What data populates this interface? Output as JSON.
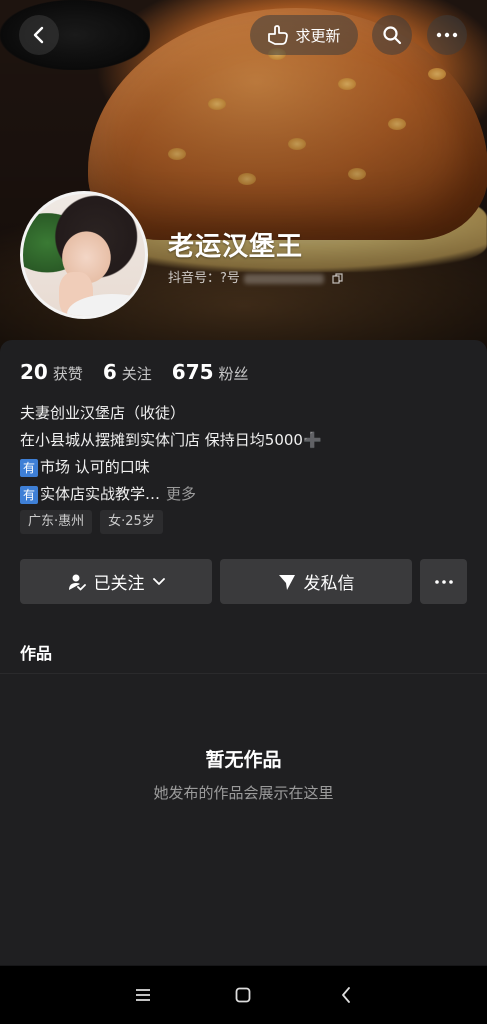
{
  "header": {
    "update_label": "求更新"
  },
  "profile": {
    "name": "老运汉堡王",
    "id_label": "抖音号：",
    "id_prefix": "?号"
  },
  "stats": [
    {
      "num": "20",
      "label": "获赞"
    },
    {
      "num": "6",
      "label": "关注"
    },
    {
      "num": "675",
      "label": "粉丝"
    }
  ],
  "bio": {
    "line1": "夫妻创业汉堡店（收徒）",
    "line2": "在小县城从摆摊到实体门店 保持日均5000",
    "line2_plus": "➕",
    "tag_char": "有",
    "line3": "市场 认可的口味",
    "line4": "实体店实战教学…",
    "more": "更多"
  },
  "chips": [
    "广东·惠州",
    "女·25岁"
  ],
  "actions": {
    "follow": "已关注",
    "message": "发私信"
  },
  "tabs": {
    "works": "作品"
  },
  "empty": {
    "title": "暂无作品",
    "subtitle": "她发布的作品会展示在这里"
  },
  "icons": {
    "back": "chevron-left-icon",
    "search": "search-icon",
    "more": "more-dots-icon",
    "hand": "pointing-hand-icon"
  }
}
